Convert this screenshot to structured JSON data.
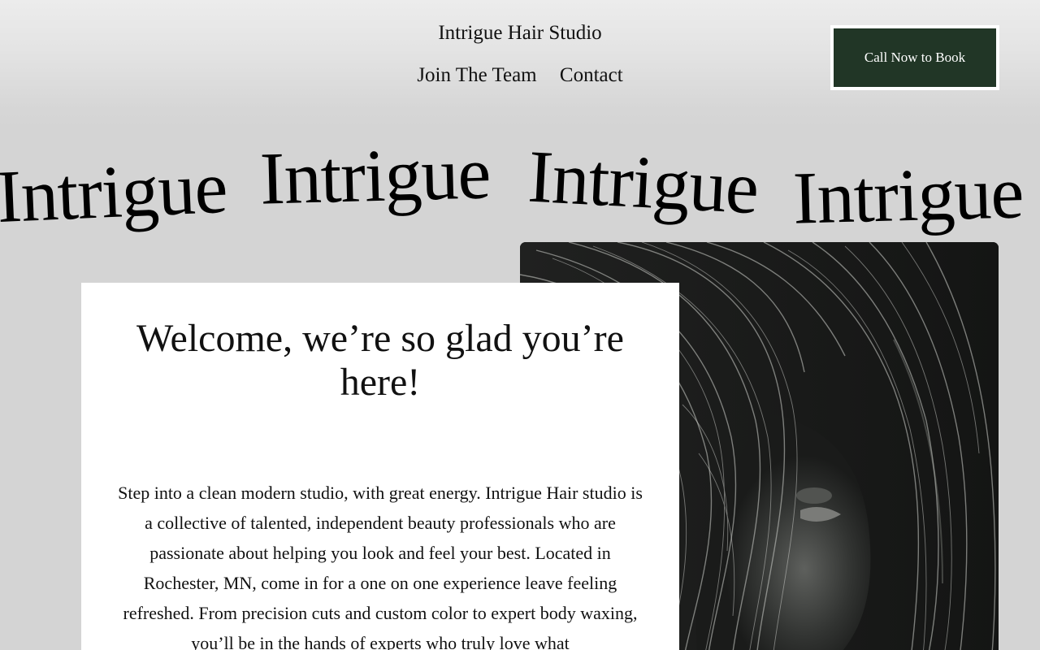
{
  "header": {
    "site_title": "Intrigue Hair Studio",
    "nav": [
      {
        "label": "Join The Team"
      },
      {
        "label": "Contact"
      }
    ],
    "cta_label": "Call Now to Book"
  },
  "marquee": {
    "words": [
      "Intrigue",
      "Intrigue",
      "Intrigue",
      "Intrigue"
    ]
  },
  "welcome": {
    "heading": "Welcome, we’re so glad you’re here!",
    "body": "Step into a clean modern studio, with great energy. Intrigue Hair studio is a collective of talented, independent beauty professionals who are passionate about helping you look and feel your best. Located in Rochester, MN, come in for a one on one experience leave feeling refreshed. From precision cuts and custom color to expert body waxing, you’ll be in the hands of experts who truly love what"
  },
  "hero_image": {
    "subject": "black-and-white portrait of a woman with long flowing hair"
  },
  "colors": {
    "background": "#d4d4d4",
    "cta_background": "#213626",
    "cta_text": "#ffffff",
    "card_background": "#ffffff"
  }
}
